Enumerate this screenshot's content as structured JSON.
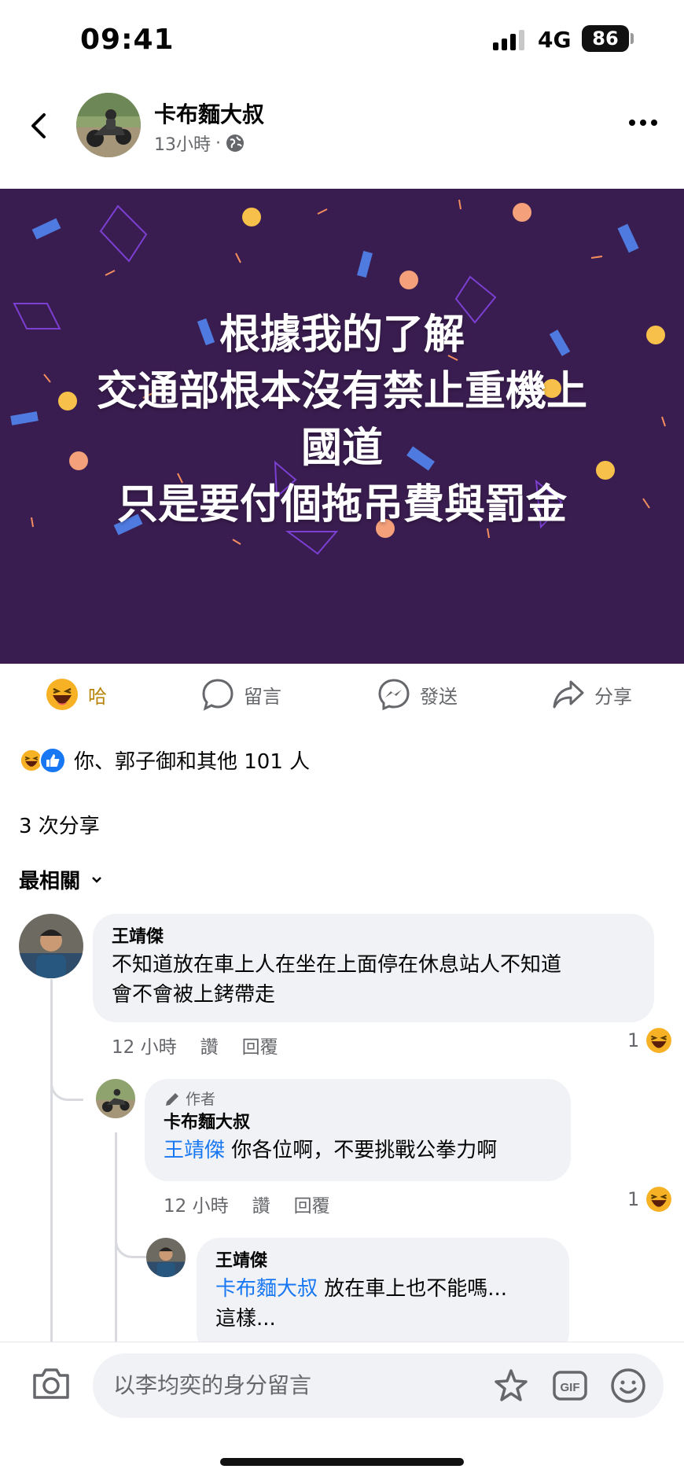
{
  "status_bar": {
    "time": "09:41",
    "network": "4G",
    "battery": "86"
  },
  "header": {
    "author": "卡布麵大叔",
    "time": "13小時",
    "dot": "·"
  },
  "banner": {
    "background": "#3a1d50",
    "lines": [
      "根據我的了解",
      "交通部根本沒有禁止重機上",
      "國道",
      "只是要付個拖吊費與罰金"
    ]
  },
  "actions": {
    "react_label": "哈",
    "comment_label": "留言",
    "send_label": "發送",
    "share_label": "分享"
  },
  "reactions": {
    "summary": "你、郭子御和其他 101 人"
  },
  "shares": {
    "text": "3 次分享"
  },
  "sort": {
    "label": "最相關"
  },
  "comments": [
    {
      "author": "王靖傑",
      "text_line1": "不知道放在車上人在坐在上面停在休息站人不知道",
      "text_line2": "會不會被上銬帶走",
      "time": "12 小時",
      "like_label": "讚",
      "reply_label": "回覆",
      "reaction_count": "1"
    },
    {
      "badge": "作者",
      "author": "卡布麵大叔",
      "mention": "王靖傑",
      "text": " 你各位啊，不要挑戰公拳力啊",
      "time": "12 小時",
      "like_label": "讚",
      "reply_label": "回覆",
      "reaction_count": "1"
    },
    {
      "author": "王靖傑",
      "mention": "卡布麵大叔",
      "text": " 放在車上也不能嗎...",
      "text_line2": "這樣..."
    }
  ],
  "composer": {
    "placeholder": "以李均奕的身分留言"
  },
  "colors": {
    "accent": "#1877f2",
    "haha": "#f7b125",
    "bubble": "#f0f2f5"
  }
}
